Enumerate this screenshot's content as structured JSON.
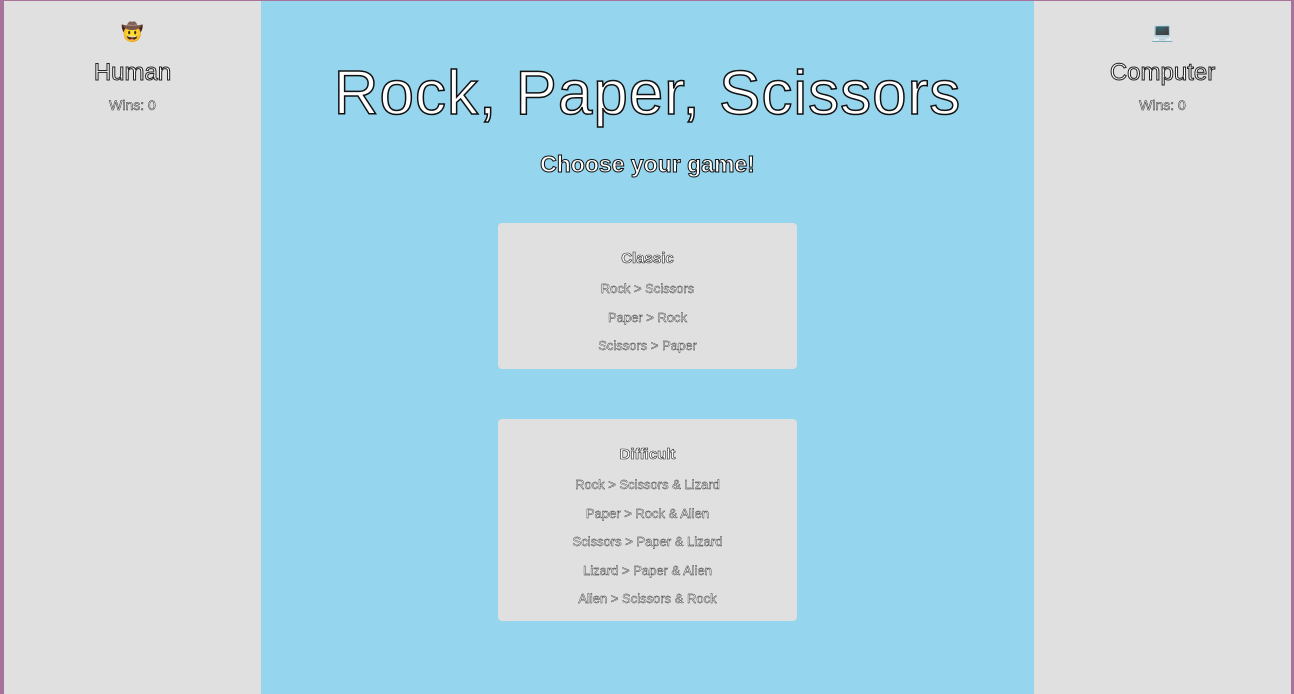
{
  "human": {
    "avatar": "🤠",
    "name": "Human",
    "wins": "Wins: 0"
  },
  "computer": {
    "avatar": "💻",
    "name": "Computer",
    "wins": "Wins: 0"
  },
  "main": {
    "title": "Rock, Paper, Scissors",
    "subtitle": "Choose your game!"
  },
  "games": {
    "classic": {
      "title": "Classic",
      "rules": [
        "Rock > Scissors",
        "Paper > Rock",
        "Scissors > Paper"
      ]
    },
    "difficult": {
      "title": "Difficult",
      "rules": [
        "Rock > Scissors & Lizard",
        "Paper > Rock & Alien",
        "Scissors > Paper & Lizard",
        "Lizard > Paper & Alien",
        "Alien > Scissors & Rock"
      ]
    }
  },
  "colors": {
    "main_background": "#95d5ed",
    "panel_background": "#e0e0e1",
    "outer_border": "#a8739a"
  }
}
